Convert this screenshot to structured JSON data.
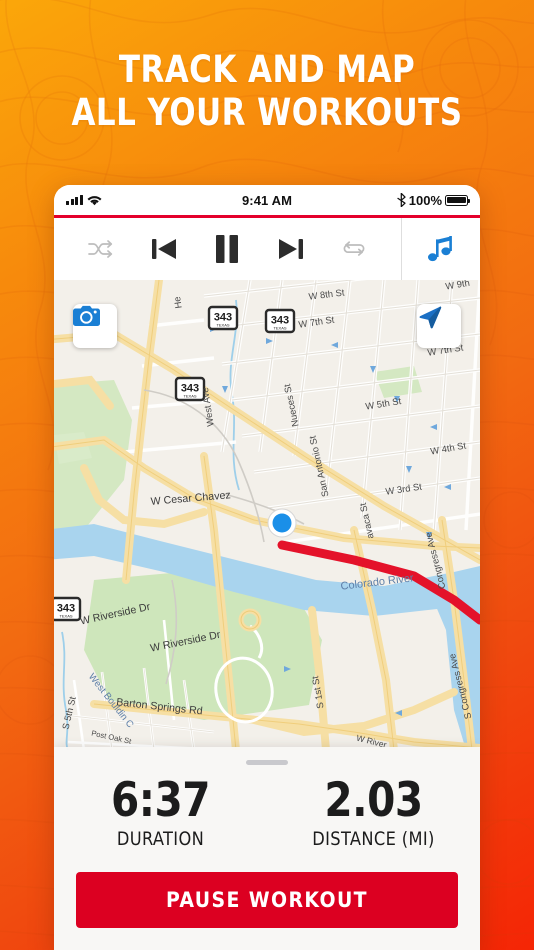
{
  "headline": {
    "line1": "TRACK AND MAP",
    "line2": "ALL YOUR WORKOUTS"
  },
  "colors": {
    "bg_top_right": "#FBA70A",
    "bg_bottom_left": "#F52505",
    "accent_red": "#DC0021",
    "status_red_line": "#E4002B",
    "blue_accent": "#1A7FD4",
    "route_red": "#E4122A",
    "location_blue": "#1A8FE8"
  },
  "phone": {
    "statusbar": {
      "signal_icon": "cellular-bars-icon",
      "wifi_icon": "wifi-icon",
      "time": "9:41 AM",
      "bluetooth_icon": "bluetooth-icon",
      "battery_percent": "100%",
      "battery_icon": "battery-full-icon"
    },
    "media_controls": [
      {
        "name": "shuffle",
        "icon": "shuffle-icon",
        "state": "inactive"
      },
      {
        "name": "previous",
        "icon": "previous-track-icon",
        "state": "active"
      },
      {
        "name": "pause",
        "icon": "pause-icon",
        "state": "active"
      },
      {
        "name": "next",
        "icon": "next-track-icon",
        "state": "active"
      },
      {
        "name": "repeat",
        "icon": "repeat-icon",
        "state": "inactive"
      },
      {
        "name": "music",
        "icon": "music-note-icon",
        "state": "highlighted"
      }
    ],
    "map": {
      "camera_button_icon": "camera-icon",
      "locate_button_icon": "navigation-arrow-icon",
      "route_color": "#E4122A",
      "current_position_marker": "blue-location-dot",
      "highway_shield_label": "343",
      "highway_shield_sub": "TEXAS",
      "labels": [
        "W 8th St",
        "W 9th St",
        "W 7th St",
        "W 5th St",
        "W 4th St",
        "W 3rd St",
        "West Ave",
        "Nueces St",
        "San Antonio St",
        "Lavaca St",
        "S Congress Ave",
        "Congress Ave",
        "S 1st St",
        "S 5th St",
        "W Cesar Chavez",
        "W Riverside Dr",
        "Colorado River",
        "West Bouldin Creek",
        "Barton Springs Rd",
        "Post Oak St",
        "He"
      ]
    },
    "stats": [
      {
        "value": "6:37",
        "label": "DURATION"
      },
      {
        "value": "2.03",
        "label": "DISTANCE (MI)"
      }
    ],
    "primary_action": "PAUSE WORKOUT"
  }
}
